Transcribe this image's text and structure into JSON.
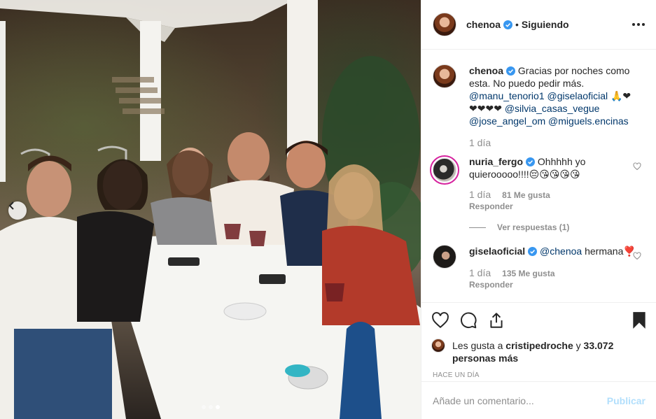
{
  "post": {
    "username": "chenoa",
    "follow_state": "Siguiendo",
    "dot": "•"
  },
  "caption": {
    "username": "chenoa",
    "text": "Gracias por noches como esta. No puedo pedir más.",
    "mentions_line1": "@manu_tenorio1 @giselaoficial",
    "emoji_line1": "🙏❤",
    "emoji_line2": "❤❤❤❤",
    "mention_silvia": "@silvia_casas_vegue",
    "mentions_line3": "@jose_angel_om @miguels.encinas",
    "time": "1 día"
  },
  "comments": [
    {
      "username": "nuria_fergo",
      "text": "Ohhhhh yo quierooooo!!!!😔😘😘😘😘",
      "time": "1 día",
      "likes": "81 Me gusta",
      "reply": "Responder",
      "view_replies": "Ver respuestas (1)"
    },
    {
      "username": "giselaoficial",
      "mention": "@chenoa",
      "text": "hermana❣️",
      "time": "1 día",
      "likes": "135 Me gusta",
      "reply": "Responder"
    }
  ],
  "likes": {
    "prefix": "Les gusta a",
    "user": "cristipedroche",
    "joiner": "y",
    "count": "33.072 personas más"
  },
  "timestamp": "HACE UN DÍA",
  "add_comment": {
    "placeholder": "Añade un comentario...",
    "publish": "Publicar"
  },
  "carousel": {
    "total": 3,
    "active_index": 2
  },
  "colors": {
    "link": "#00376b",
    "muted": "#8e8e8e",
    "publish_disabled": "#b2dffc",
    "verified": "#3897f0",
    "story_ring": "#d6249f"
  }
}
